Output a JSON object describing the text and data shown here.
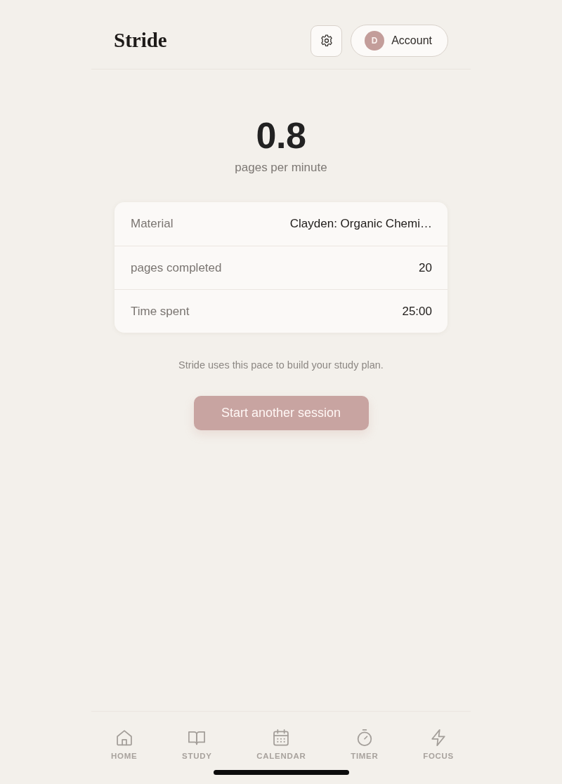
{
  "header": {
    "logo": "Stride",
    "account": {
      "initial": "D",
      "label": "Account"
    }
  },
  "result": {
    "value": "0.8",
    "unit": "pages per minute"
  },
  "details": [
    {
      "label": "Material",
      "value": "Clayden: Organic Chemi…"
    },
    {
      "label": "pages completed",
      "value": "20"
    },
    {
      "label": "Time spent",
      "value": "25:00"
    }
  ],
  "note": "Stride uses this pace to build your study plan.",
  "primary_button": "Start another session",
  "tab_bar": [
    {
      "label": "HOME"
    },
    {
      "label": "STUDY"
    },
    {
      "label": "CALENDAR"
    },
    {
      "label": "TIMER"
    },
    {
      "label": "FOCUS"
    }
  ]
}
